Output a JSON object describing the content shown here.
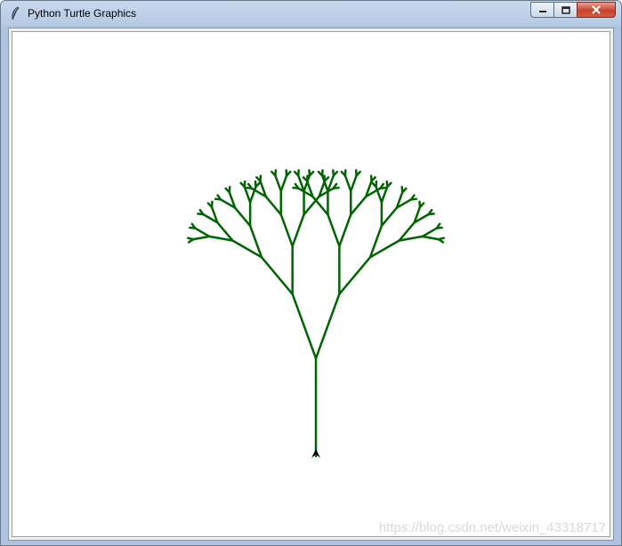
{
  "window": {
    "title": "Python Turtle Graphics",
    "icon": "feather-icon",
    "controls": [
      "minimize-icon",
      "maximize-icon",
      "close-icon"
    ]
  },
  "canvas": {
    "background": "#ffffff",
    "pen_color": "#006400",
    "drawing": "fractal-tree",
    "trunk_length": 110,
    "branch_angle_deg": 20,
    "depth": 5,
    "turtle_icon": "arrow-turtle-icon"
  },
  "watermark": "https://blog.csdn.net/weixin_43318717"
}
